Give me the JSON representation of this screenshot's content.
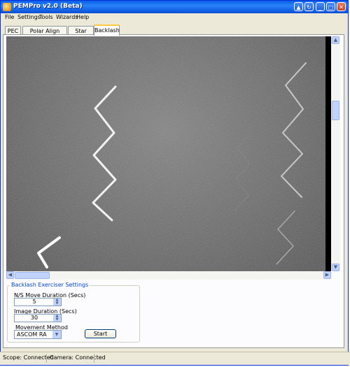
{
  "window": {
    "title": "PEMPro v2.0 (Beta)",
    "buttons": [
      "minimize-icon",
      "restore-icon",
      "minimize-button",
      "maximize-button",
      "close-button"
    ]
  },
  "menu": [
    "File",
    "Settings",
    "Tools",
    "Wizards",
    "Help"
  ],
  "tabs": [
    {
      "label": "PEC",
      "active": false
    },
    {
      "label": "Polar Align Wizard",
      "active": false
    },
    {
      "label": "Star Finder",
      "active": false
    },
    {
      "label": "Backlash",
      "active": true
    }
  ],
  "settings": {
    "group_title": "Backlash Exerciser Settings",
    "ns_move_label": "N/S Move Duration (Secs)",
    "ns_move_value": "5",
    "image_duration_label": "Image Duration (Secs)",
    "image_duration_value": "30",
    "movement_label": "Movement Method",
    "movement_value": "ASCOM RA",
    "start_label": "Start"
  },
  "status": {
    "scope": "Scope: Connected",
    "camera": "Camera: Connected"
  }
}
